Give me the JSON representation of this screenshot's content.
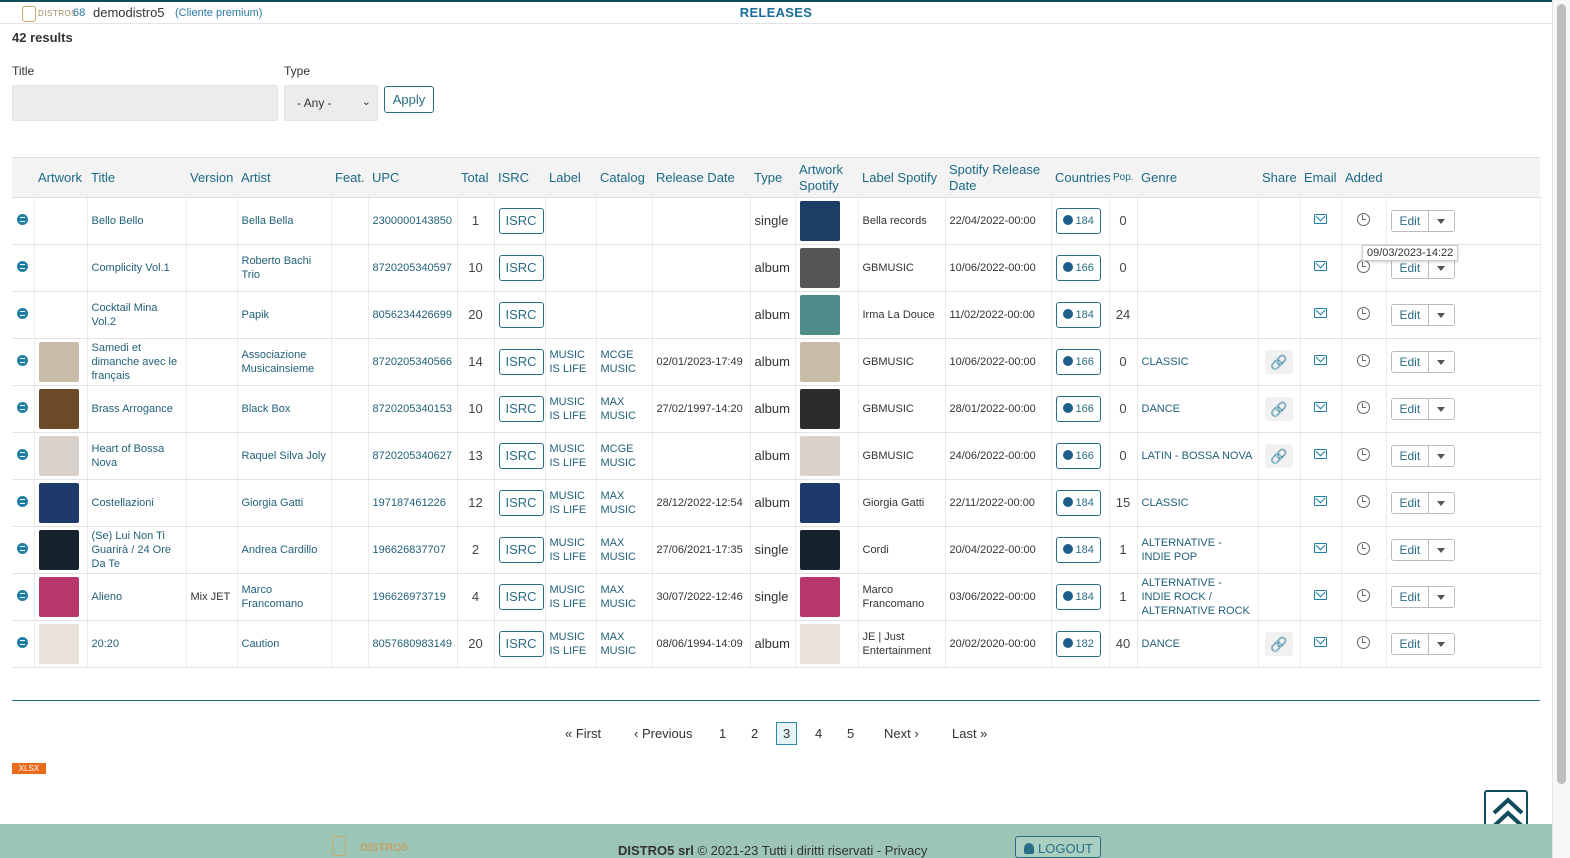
{
  "header": {
    "logo_text": "DISTRO5",
    "count": "68",
    "username": "demodistro5",
    "account_type": "(Cliente premium)",
    "page_title": "RELEASES"
  },
  "results_label": "42 results",
  "filters": {
    "title_label": "Title",
    "title_value": "",
    "type_label": "Type",
    "type_selected": "- Any -",
    "apply_label": "Apply"
  },
  "table": {
    "columns": [
      "Artwork",
      "Title",
      "Version",
      "Artist",
      "Feat.",
      "UPC",
      "Total",
      "ISRC",
      "Label",
      "Catalog",
      "Release Date",
      "Type",
      "Artwork Spotify",
      "Label Spotify",
      "Spotify Release Date",
      "Countries",
      "Pop.",
      "Genre",
      "Share",
      "Email",
      "Added",
      ""
    ],
    "isrc_label": "ISRC",
    "edit_label": "Edit",
    "rows": [
      {
        "title": "Bello Bello",
        "version": "",
        "artist": "Bella Bella",
        "feat": "",
        "upc": "2300000143850",
        "total": "1",
        "label": "",
        "catalog": "",
        "release_date": "",
        "type": "single",
        "label_spotify": "Bella records",
        "spotify_date": "22/04/2022-00:00",
        "countries": "184",
        "pop": "0",
        "genre": "",
        "share": false,
        "has_artwork": false,
        "art_color": "#1b3e64",
        "spot_color": "#1b3e64"
      },
      {
        "title": "Complicity Vol.1",
        "version": "",
        "artist": "Roberto Bachi Trio",
        "feat": "",
        "upc": "8720205340597",
        "total": "10",
        "label": "",
        "catalog": "",
        "release_date": "",
        "type": "album",
        "label_spotify": "GBMUSIC",
        "spotify_date": "10/06/2022-00:00",
        "countries": "166",
        "pop": "0",
        "genre": "",
        "share": false,
        "has_artwork": false,
        "art_color": "#555555",
        "spot_color": "#555555"
      },
      {
        "title": "Cocktail Mina Vol.2",
        "version": "",
        "artist": "Papik",
        "feat": "",
        "upc": "8056234426699",
        "total": "20",
        "label": "",
        "catalog": "",
        "release_date": "",
        "type": "album",
        "label_spotify": "Irma La Douce",
        "spotify_date": "11/02/2022-00:00",
        "countries": "184",
        "pop": "24",
        "genre": "",
        "share": false,
        "has_artwork": false,
        "art_color": "#4e8c8a",
        "spot_color": "#4e8c8a"
      },
      {
        "title": "Samedi et dimanche avec le français",
        "version": "",
        "artist": "Associazione Musicainsieme",
        "feat": "",
        "upc": "8720205340566",
        "total": "14",
        "label": "MUSIC IS LIFE",
        "catalog": "MCGE MUSIC",
        "release_date": "02/01/2023-17:49",
        "type": "album",
        "label_spotify": "GBMUSIC",
        "spotify_date": "10/06/2022-00:00",
        "countries": "166",
        "pop": "0",
        "genre": "CLASSIC",
        "share": true,
        "has_artwork": true,
        "art_color": "#c8bba8",
        "spot_color": "#c8bba8"
      },
      {
        "title": "Brass Arrogance",
        "version": "",
        "artist": "Black Box",
        "feat": "",
        "upc": "8720205340153",
        "total": "10",
        "label": "MUSIC IS LIFE",
        "catalog": "MAX MUSIC",
        "release_date": "27/02/1997-14:20",
        "type": "album",
        "label_spotify": "GBMUSIC",
        "spotify_date": "28/01/2022-00:00",
        "countries": "166",
        "pop": "0",
        "genre": "DANCE",
        "share": true,
        "has_artwork": true,
        "art_color": "#6b4a2a",
        "spot_color": "#2b2b2b"
      },
      {
        "title": "Heart of Bossa Nova",
        "version": "",
        "artist": "Raquel Silva Joly",
        "feat": "",
        "upc": "8720205340627",
        "total": "13",
        "label": "MUSIC IS LIFE",
        "catalog": "MCGE MUSIC",
        "release_date": "",
        "type": "album",
        "label_spotify": "GBMUSIC",
        "spotify_date": "24/06/2022-00:00",
        "countries": "166",
        "pop": "0",
        "genre": "LATIN - BOSSA NOVA",
        "share": true,
        "has_artwork": true,
        "art_color": "#d9d2cc",
        "spot_color": "#d9d2cc"
      },
      {
        "title": "Costellazioni",
        "version": "",
        "artist": "Giorgia Gatti",
        "feat": "",
        "upc": "197187461226",
        "total": "12",
        "label": "MUSIC IS LIFE",
        "catalog": "MAX MUSIC",
        "release_date": "28/12/2022-12:54",
        "type": "album",
        "label_spotify": "Giorgia Gatti",
        "spotify_date": "22/11/2022-00:00",
        "countries": "184",
        "pop": "15",
        "genre": "CLASSIC",
        "share": false,
        "has_artwork": true,
        "art_color": "#1e3a6a",
        "spot_color": "#1e3a6a"
      },
      {
        "title": "(Se) Lui Non Ti Guarirà / 24 Ore Da Te",
        "version": "",
        "artist": "Andrea Cardillo",
        "feat": "",
        "upc": "196626837707",
        "total": "2",
        "label": "MUSIC IS LIFE",
        "catalog": "MAX MUSIC",
        "release_date": "27/06/2021-17:35",
        "type": "single",
        "label_spotify": "Cordi",
        "spotify_date": "20/04/2022-00:00",
        "countries": "184",
        "pop": "1",
        "genre": "ALTERNATIVE - INDIE POP",
        "share": false,
        "has_artwork": true,
        "art_color": "#16222e",
        "spot_color": "#16222e"
      },
      {
        "title": "Alieno",
        "version": "Mix JET",
        "artist": "Marco Francomano",
        "feat": "",
        "upc": "196626973719",
        "total": "4",
        "label": "MUSIC IS LIFE",
        "catalog": "MAX MUSIC",
        "release_date": "30/07/2022-12:46",
        "type": "single",
        "label_spotify": "Marco Francomano",
        "spotify_date": "03/06/2022-00:00",
        "countries": "184",
        "pop": "1",
        "genre": "ALTERNATIVE - INDIE ROCK / ALTERNATIVE ROCK",
        "share": false,
        "has_artwork": true,
        "art_color": "#b8386e",
        "spot_color": "#b8386e"
      },
      {
        "title": "20:20",
        "version": "",
        "artist": "Caution",
        "feat": "",
        "upc": "8057680983149",
        "total": "20",
        "label": "MUSIC IS LIFE",
        "catalog": "MAX MUSIC",
        "release_date": "08/06/1994-14:09",
        "type": "album",
        "label_spotify": "JE | Just Entertainment",
        "spotify_date": "20/02/2020-00:00",
        "countries": "182",
        "pop": "40",
        "genre": "DANCE",
        "share": true,
        "has_artwork": true,
        "art_color": "#e8e2d8",
        "spot_color": "#e8e2d8"
      }
    ]
  },
  "tooltip": "09/03/2023-14:22",
  "pagination": {
    "first": "« First",
    "previous": "‹ Previous",
    "pages": [
      "1",
      "2",
      "3",
      "4",
      "5"
    ],
    "current": "3",
    "next": "Next ›",
    "last": "Last »"
  },
  "export_label": "XLSX",
  "footer": {
    "logo_text": "DISTRO5",
    "company": "DISTRO5 srl",
    "copyright": "© 2021-23  Tutti i diritti riservati - Privacy",
    "logout_label": "LOGOUT"
  },
  "colors": {
    "accent": "#2a6e86",
    "link": "#1b6a86",
    "footer_bg": "#9cc5b5",
    "export_badge": "#ea6a1b"
  }
}
